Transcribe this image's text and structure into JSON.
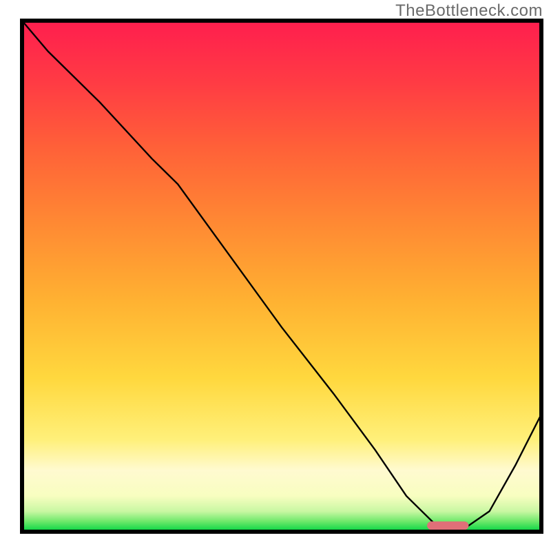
{
  "watermark": "TheBottleneck.com",
  "chart_data": {
    "type": "line",
    "title": "",
    "xlabel": "",
    "ylabel": "",
    "xlim": [
      0,
      100
    ],
    "ylim": [
      0,
      100
    ],
    "series": [
      {
        "name": "bottleneck-curve",
        "x": [
          0,
          5,
          15,
          25,
          30,
          40,
          50,
          60,
          68,
          74,
          80,
          82,
          85,
          90,
          95,
          100
        ],
        "y": [
          100,
          94,
          84,
          73,
          68,
          54,
          40,
          27,
          16,
          7,
          1,
          0.5,
          0.5,
          4,
          13,
          23
        ]
      }
    ],
    "marker": {
      "name": "optimal-range",
      "x_start": 78,
      "x_end": 86,
      "y": 1.2,
      "color": "#e06f78"
    },
    "gradient_stops": [
      {
        "offset": 0.0,
        "color": "#00d441"
      },
      {
        "offset": 0.02,
        "color": "#6de86a"
      },
      {
        "offset": 0.04,
        "color": "#c9f7a3"
      },
      {
        "offset": 0.07,
        "color": "#f8fec0"
      },
      {
        "offset": 0.12,
        "color": "#fffad0"
      },
      {
        "offset": 0.18,
        "color": "#fff07a"
      },
      {
        "offset": 0.3,
        "color": "#ffd83e"
      },
      {
        "offset": 0.45,
        "color": "#ffb232"
      },
      {
        "offset": 0.6,
        "color": "#ff8a33"
      },
      {
        "offset": 0.75,
        "color": "#ff6138"
      },
      {
        "offset": 0.88,
        "color": "#ff3b44"
      },
      {
        "offset": 1.0,
        "color": "#ff1e4e"
      }
    ]
  }
}
